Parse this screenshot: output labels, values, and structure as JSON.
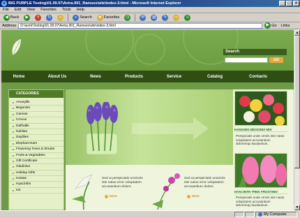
{
  "window": {
    "title": "BIG PURPLE Testing\\01.09.07\\Avtra.901_Ramses\\site\\index-3.html - Microsoft Internet Explorer",
    "minimize": "_",
    "maximize": "□",
    "close": "×"
  },
  "menu": [
    "File",
    "Edit",
    "View",
    "Favorites",
    "Tools",
    "Help"
  ],
  "toolbar": {
    "back": "Back",
    "search": "Search",
    "favorites": "Favorites"
  },
  "address": {
    "label": "Address",
    "value": "D:\\work\\Testing\\01.09.07\\Avtra.901_Ramses\\site\\index-3.html",
    "go": "Go",
    "links": "Links"
  },
  "site": {
    "search_title": "Search",
    "search_go": "GO",
    "nav": [
      "Home",
      "About Us",
      "News",
      "Products",
      "Service",
      "Catalog",
      "Contacts"
    ],
    "categories_title": "CATEGORIES",
    "categories": [
      "Amaryllis",
      "Begonias",
      "Cannas",
      "Crocus",
      "Daffodils",
      "Dahlias",
      "Daylilies",
      "Elephant Ears",
      "Flowering Trees & Shrubs",
      "Fruits & Vegetables",
      "Gift Certificate",
      "Gladiolus",
      "Holiday Gifts",
      "Hostas",
      "Hyacinths",
      "Iris"
    ],
    "promos": [
      {
        "text": "Sed ut perspiciatis unomnis iste natus error voluptatem accusantium dolore.",
        "more": "More"
      },
      {
        "text": "Sed ut perspiciatis unomnis iste natus error voluptatem accusantium dolore.",
        "more": "More"
      }
    ],
    "side_items": [
      {
        "title": "HANGING BEGONIA MIX",
        "text": "Perspiciatis unde omnis iste natus voluptatem accusantium doloremqu laudantium."
      },
      {
        "title": "HYACINTH 'PINK FROSTING'",
        "text": "Perspiciatis unde omnis iste natus voluptatem accusantium doloremqu laudantium."
      }
    ]
  },
  "status": {
    "left": "",
    "zone": "My Computer"
  },
  "colors": {
    "site_green": "#6d9a45",
    "nav_dark": "#2f4e14",
    "accent_orange": "#e9a93a"
  }
}
